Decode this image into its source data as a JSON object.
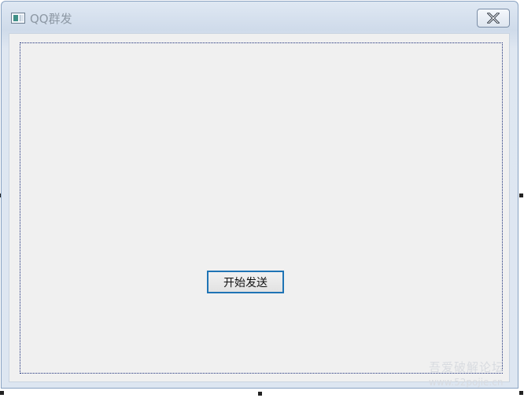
{
  "window": {
    "title": "QQ群发",
    "close_icon": "close-icon"
  },
  "main": {
    "start_button_label": "开始发送"
  },
  "watermark": {
    "line1": "吾爱破解论坛",
    "line2": "www.52pojie.cn"
  },
  "colors": {
    "titlebar": "#cfdbea",
    "client_background": "#f0f0f0",
    "button_focus_border": "#1f74b5",
    "selection_border": "#1c2f7a"
  }
}
